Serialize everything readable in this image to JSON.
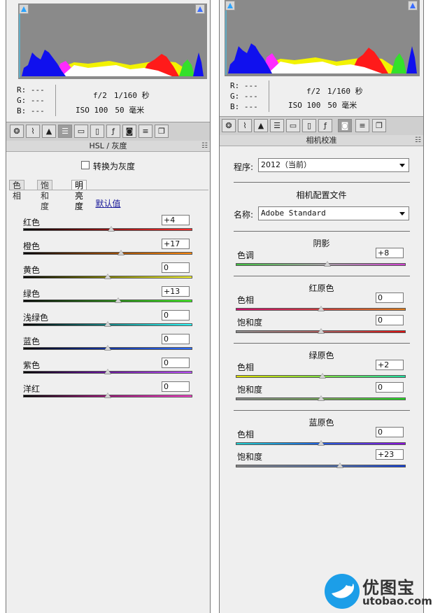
{
  "colors": {
    "panel_bg": "#efefef",
    "histogram_bg": "#8a8a8a",
    "accent_blue": "#3a6cff",
    "link": "#1a1a9a"
  },
  "icons": [
    "aperture-icon",
    "tone-curve-icon",
    "detail-icon",
    "hsl-icon",
    "split-toning-icon",
    "lens-corrections-icon",
    "effects-icon",
    "camera-calibration-icon",
    "presets-icon",
    "snapshots-icon"
  ],
  "left": {
    "readout": {
      "r": "R:  ---",
      "g": "G:  ---",
      "b": "B:  ---"
    },
    "exif": {
      "aperture": "f/2",
      "shutter": "1/160 秒",
      "iso": "ISO 100",
      "focal": "50 毫米"
    },
    "header_title": "HSL / 灰度",
    "grayscale_label": "转换为灰度",
    "tabs": [
      {
        "label": "色相",
        "active": false
      },
      {
        "label": "饱和度",
        "active": false
      },
      {
        "label": "明亮度",
        "active": true
      }
    ],
    "default_link": "默认值",
    "sliders": [
      {
        "label": "红色",
        "value": "+4",
        "pos": 0.52
      },
      {
        "label": "橙色",
        "value": "+17",
        "pos": 0.58
      },
      {
        "label": "黄色",
        "value": "0",
        "pos": 0.5
      },
      {
        "label": "绿色",
        "value": "+13",
        "pos": 0.56
      },
      {
        "label": "浅绿色",
        "value": "0",
        "pos": 0.5
      },
      {
        "label": "蓝色",
        "value": "0",
        "pos": 0.5
      },
      {
        "label": "紫色",
        "value": "0",
        "pos": 0.5
      },
      {
        "label": "洋红",
        "value": "0",
        "pos": 0.5
      }
    ]
  },
  "right": {
    "readout": {
      "r": "R:  ---",
      "g": "G:  ---",
      "b": "B:  ---"
    },
    "exif": {
      "aperture": "f/2",
      "shutter": "1/160 秒",
      "iso": "ISO 100",
      "focal": "50 毫米"
    },
    "header_title": "相机校准",
    "process_label": "程序:",
    "process_value": "2012（当前）",
    "profile_title": "相机配置文件",
    "name_label": "名称:",
    "name_value": "Adobe Standard",
    "shadows_title": "阴影",
    "shadow_tint": {
      "label": "色调",
      "value": "+8",
      "pos": 0.54
    },
    "red_title": "红原色",
    "red_hue": {
      "label": "色相",
      "value": "0",
      "pos": 0.5
    },
    "red_sat": {
      "label": "饱和度",
      "value": "0",
      "pos": 0.5
    },
    "green_title": "绿原色",
    "green_hue": {
      "label": "色相",
      "value": "+2",
      "pos": 0.51
    },
    "green_sat": {
      "label": "饱和度",
      "value": "0",
      "pos": 0.5
    },
    "blue_title": "蓝原色",
    "blue_hue": {
      "label": "色相",
      "value": "0",
      "pos": 0.5
    },
    "blue_sat": {
      "label": "饱和度",
      "value": "+23",
      "pos": 0.615
    }
  },
  "watermark": {
    "name": "优图宝",
    "url": "utobao.com"
  }
}
